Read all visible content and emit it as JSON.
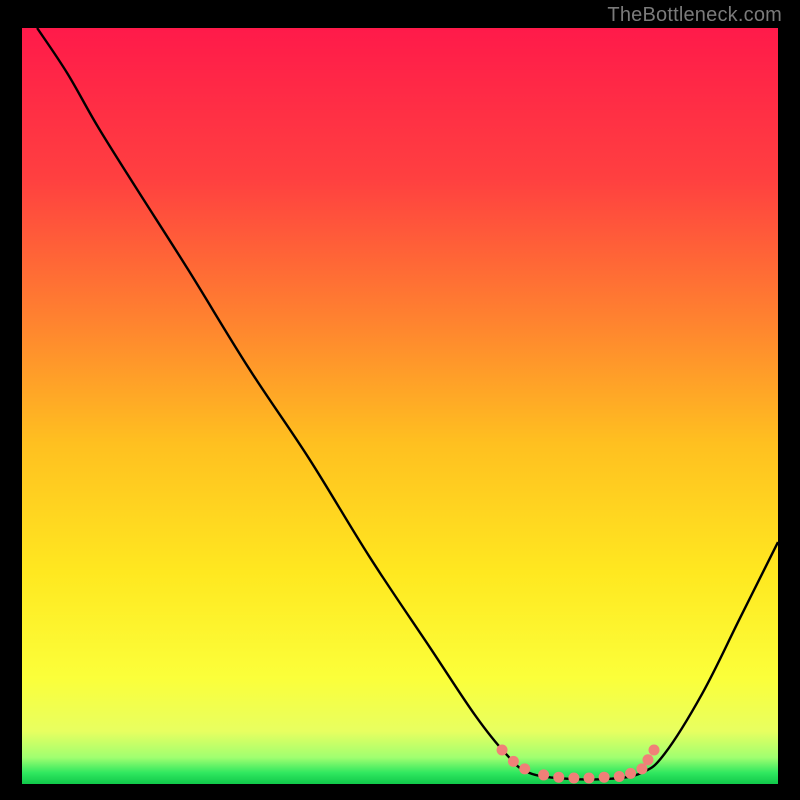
{
  "attribution": "TheBottleneck.com",
  "chart_data": {
    "type": "line",
    "title": "",
    "xlabel": "",
    "ylabel": "",
    "xlim": [
      0,
      100
    ],
    "ylim": [
      0,
      100
    ],
    "gradient": {
      "stops": [
        {
          "offset": 0.0,
          "color": "#ff1a4a"
        },
        {
          "offset": 0.2,
          "color": "#ff4040"
        },
        {
          "offset": 0.38,
          "color": "#ff8030"
        },
        {
          "offset": 0.55,
          "color": "#ffc020"
        },
        {
          "offset": 0.72,
          "color": "#ffe820"
        },
        {
          "offset": 0.86,
          "color": "#fbff3a"
        },
        {
          "offset": 0.93,
          "color": "#e8ff60"
        },
        {
          "offset": 0.965,
          "color": "#a0ff70"
        },
        {
          "offset": 0.985,
          "color": "#30e860"
        },
        {
          "offset": 1.0,
          "color": "#10c84a"
        }
      ]
    },
    "series": [
      {
        "name": "bottleneck-curve",
        "color": "#000000",
        "points": [
          {
            "x": 2,
            "y": 100
          },
          {
            "x": 6,
            "y": 94
          },
          {
            "x": 10,
            "y": 87
          },
          {
            "x": 15,
            "y": 79
          },
          {
            "x": 22,
            "y": 68
          },
          {
            "x": 30,
            "y": 55
          },
          {
            "x": 38,
            "y": 43
          },
          {
            "x": 46,
            "y": 30
          },
          {
            "x": 54,
            "y": 18
          },
          {
            "x": 60,
            "y": 9
          },
          {
            "x": 64,
            "y": 4
          },
          {
            "x": 67,
            "y": 1.5
          },
          {
            "x": 72,
            "y": 0.7
          },
          {
            "x": 78,
            "y": 0.7
          },
          {
            "x": 82,
            "y": 1.5
          },
          {
            "x": 85,
            "y": 4
          },
          {
            "x": 90,
            "y": 12
          },
          {
            "x": 95,
            "y": 22
          },
          {
            "x": 100,
            "y": 32
          }
        ]
      }
    ],
    "markers": {
      "name": "optimal-range-markers",
      "color": "#f08078",
      "points": [
        {
          "x": 63.5,
          "y": 4.5
        },
        {
          "x": 65.0,
          "y": 3.0
        },
        {
          "x": 66.5,
          "y": 2.0
        },
        {
          "x": 69.0,
          "y": 1.2
        },
        {
          "x": 71.0,
          "y": 0.9
        },
        {
          "x": 73.0,
          "y": 0.8
        },
        {
          "x": 75.0,
          "y": 0.8
        },
        {
          "x": 77.0,
          "y": 0.9
        },
        {
          "x": 79.0,
          "y": 1.0
        },
        {
          "x": 80.5,
          "y": 1.4
        },
        {
          "x": 82.0,
          "y": 2.0
        },
        {
          "x": 82.8,
          "y": 3.2
        },
        {
          "x": 83.6,
          "y": 4.5
        }
      ]
    }
  }
}
